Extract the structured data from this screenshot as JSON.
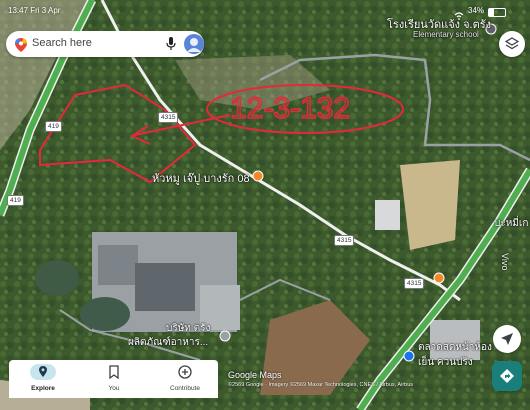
{
  "status_bar": {
    "time_date": "13:47  Fri 3 Apr",
    "battery_text": "34%"
  },
  "search": {
    "placeholder": "Search here"
  },
  "map": {
    "annotation_text": "12-3-132",
    "labels": {
      "school_thai": "โรงเรียนวัดแจ้ง จ.ตรัง",
      "school_en": "Elementary school",
      "restaurant": "หัวหมู เจ๊ปู บางรัก 08",
      "company_line1": "บริษัท ตรัง",
      "company_line2": "ผลิตภัณฑ์อาหาร...",
      "market_line1": "ตลาดสดหน้าห้อง",
      "market_line2": "เย็น ควนปริง",
      "right_edge_1": "บะหมี่เก",
      "right_edge_2": "Vivo"
    },
    "road_shields": {
      "r419_top": "419",
      "r419_bottom": "419",
      "r4315_a": "4315",
      "r4315_b": "4315",
      "r4315_c": "4315"
    },
    "attribution": "©2569 Google · Imagery ©2569 Maxar Technologies, CNES / Airbus, Airbus",
    "logo_text": "Google Maps"
  },
  "bottom_nav": {
    "tabs": [
      {
        "label": "Explore",
        "icon": "location-pin-icon",
        "active": true
      },
      {
        "label": "You",
        "icon": "bookmark-icon",
        "active": false
      },
      {
        "label": "Contribute",
        "icon": "plus-circle-icon",
        "active": false
      }
    ]
  },
  "colors": {
    "annotation_red": "#e5283a",
    "road_white": "#f0f0f0",
    "highway_green": "#4fae4f",
    "directions_teal": "#1a7f7a"
  }
}
